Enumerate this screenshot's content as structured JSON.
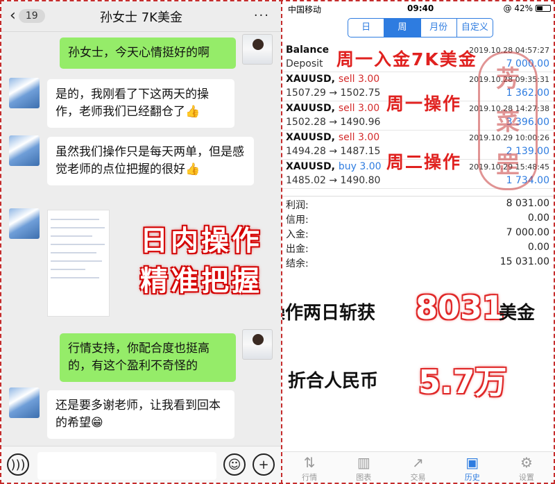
{
  "chat": {
    "back_count": "19",
    "title": "孙女士 7K美金",
    "more_glyph": "···",
    "messages": [
      {
        "side": "right",
        "text": "孙女士，今天心情挺好的啊"
      },
      {
        "side": "left",
        "text": "是的，我刚看了下这两天的操作，老师我们已经翻仓了👍"
      },
      {
        "side": "left",
        "text": "虽然我们操作只是每天两单，但是感觉老师的点位把握的很好👍"
      },
      {
        "side": "right",
        "text": "行情支持，你配合度也挺高的，有这个盈利不奇怪的"
      },
      {
        "side": "left",
        "text": "还是要多谢老师，让我看到回本的希望😁"
      }
    ],
    "overlay": "日内操作精准把握"
  },
  "app": {
    "status": {
      "carrier": "中国移动",
      "time": "09:40",
      "battery": "@ 42%"
    },
    "segments": [
      {
        "label": "日",
        "active": false
      },
      {
        "label": "周",
        "active": true
      },
      {
        "label": "月份",
        "active": false
      },
      {
        "label": "自定义",
        "active": false
      }
    ],
    "rows": [
      {
        "symbol": "Balance",
        "action": "",
        "sub": "Deposit",
        "datetime": "2019.10.28 04:57:27",
        "amount": "7 000.00"
      },
      {
        "symbol": "XAUUSD,",
        "action": "sell 3.00",
        "sub": "1507.29 → 1502.75",
        "datetime": "2019.10.28 09:35:31",
        "amount": "1 362.00"
      },
      {
        "symbol": "XAUUSD,",
        "action": "sell 3.00",
        "sub": "1502.28 → 1490.96",
        "datetime": "2019.10.28 14:27:38",
        "amount": "3 396.00"
      },
      {
        "symbol": "XAUUSD,",
        "action": "sell 3.00",
        "sub": "1494.28 → 1487.15",
        "datetime": "2019.10.29 10:00:26",
        "amount": "2 139.00"
      },
      {
        "symbol": "XAUUSD,",
        "action": "buy 3.00",
        "sub": "1485.02 → 1490.80",
        "datetime": "2019.10.29 15:48:45",
        "amount": "1 734.00"
      }
    ],
    "summary": [
      {
        "label": "利润:",
        "value": "8 031.00"
      },
      {
        "label": "信用:",
        "value": "0.00"
      },
      {
        "label": "入金:",
        "value": "7 000.00"
      },
      {
        "label": "出金:",
        "value": "0.00"
      },
      {
        "label": "结余:",
        "value": "15 031.00"
      }
    ],
    "annotations": {
      "a1": "周一入金7K美金",
      "a2": "周一操作",
      "a3": "周二操作",
      "stamp": "芳菜罡"
    },
    "promo": {
      "line1_prefix": "操作两日斩获",
      "line1_number": "8031",
      "line1_suffix": "美金",
      "line2_prefix": "折合人民币",
      "line2_number": "5.7万"
    },
    "tabs": [
      {
        "label": "行情",
        "icon": "quotes-icon",
        "active": false
      },
      {
        "label": "图表",
        "icon": "chart-icon",
        "active": false
      },
      {
        "label": "交易",
        "icon": "trade-icon",
        "active": false
      },
      {
        "label": "历史",
        "icon": "history-icon",
        "active": true
      },
      {
        "label": "设置",
        "icon": "settings-icon",
        "active": false
      }
    ]
  }
}
